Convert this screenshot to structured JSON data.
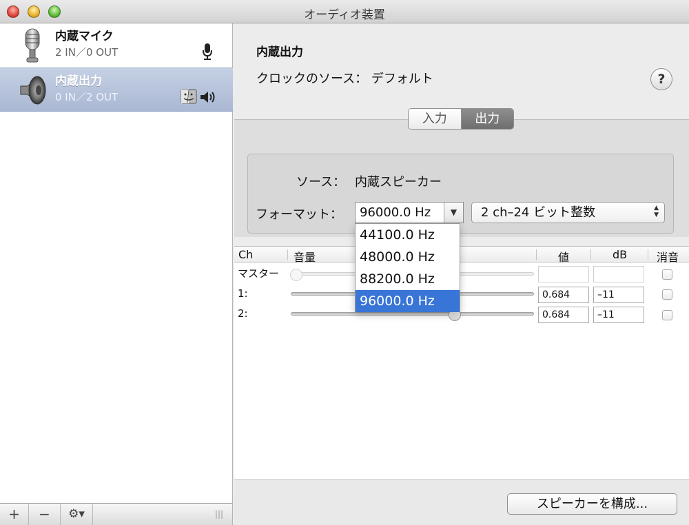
{
  "window": {
    "title": "オーディオ装置"
  },
  "sidebar": {
    "devices": [
      {
        "name": "内蔵マイク",
        "io": "2 IN／0 OUT",
        "icon": "microphone-icon",
        "status_icon": "mic-small-icon"
      },
      {
        "name": "内蔵出力",
        "io": "0 IN／2 OUT",
        "icon": "speaker-icon",
        "status_icon": "finder-icon",
        "status_icon2": "volume-icon"
      }
    ],
    "toolbar": {
      "add": "+",
      "remove": "−",
      "gear": "⚙▾",
      "resize": "|||"
    }
  },
  "header": {
    "device_name": "内蔵出力",
    "clock_source": "クロックのソース：  デフォルト",
    "help": "?"
  },
  "tabs": [
    {
      "label": "入力"
    },
    {
      "label": "出力"
    }
  ],
  "settings": {
    "source_label": "ソース：",
    "source_value": "内蔵スピーカー",
    "format_label": "フォーマット：",
    "format_rate": "96000.0 Hz",
    "format_bits": "2 ch–24 ビット整数"
  },
  "dropdown": {
    "options": [
      "44100.0 Hz",
      "48000.0 Hz",
      "88200.0 Hz",
      "96000.0 Hz"
    ],
    "selected_index": 3
  },
  "table": {
    "headers": {
      "ch": "Ch",
      "volume": "音量",
      "value": "値",
      "db": "dB",
      "mute": "消音"
    },
    "rows": [
      {
        "ch": "マスター",
        "level": 0,
        "value": "",
        "db": "",
        "muted": false,
        "enabled": false
      },
      {
        "ch": "1:",
        "level": 0.684,
        "value": "0.684",
        "db": "–11",
        "muted": false,
        "enabled": true
      },
      {
        "ch": "2:",
        "level": 0.684,
        "value": "0.684",
        "db": "–11",
        "muted": false,
        "enabled": true
      }
    ]
  },
  "footer": {
    "configure_button": "スピーカーを構成..."
  }
}
